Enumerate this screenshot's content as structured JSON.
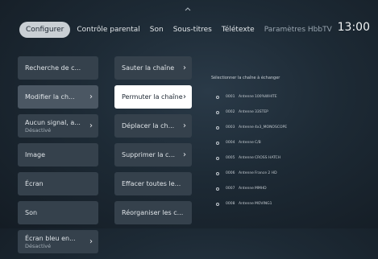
{
  "tabs": [
    {
      "label": "Configurer",
      "active": true
    },
    {
      "label": "Contrôle parental"
    },
    {
      "label": "Son"
    },
    {
      "label": "Sous-titres"
    },
    {
      "label": "Télétexte"
    },
    {
      "label": "Paramètres HbbTV",
      "faded": true
    }
  ],
  "clock": "13:00",
  "menu": [
    {
      "label": "Recherche de c..."
    },
    {
      "label": "Modifier la ch...",
      "arrow": "›"
    },
    {
      "label": "Aucun signal, a...",
      "sub": "Désactivé",
      "arrow": "›"
    },
    {
      "label": "Image"
    },
    {
      "label": "Écran"
    },
    {
      "label": "Son"
    },
    {
      "label": "Écran bleu en...",
      "sub": "Désactivé",
      "arrow": "›"
    }
  ],
  "submenu": [
    {
      "label": "Sauter la chaîne",
      "arrow": "›"
    },
    {
      "label": "Permuter la chaîne",
      "arrow": "›"
    },
    {
      "label": "Déplacer la ch...",
      "arrow": "›"
    },
    {
      "label": "Supprimer la c...",
      "arrow": "›"
    },
    {
      "label": "Effacer toutes le..."
    },
    {
      "label": "Réorganiser les c..."
    }
  ],
  "channel_panel": {
    "title": "Sélectionner la chaîne à échanger",
    "channels": [
      {
        "num": "0001",
        "source": "Antenne",
        "name": "100%WHITE"
      },
      {
        "num": "0002",
        "source": "Antenne",
        "name": "33STEP"
      },
      {
        "num": "0003",
        "source": "Antenne",
        "name": "4x3_MONOSCOPE"
      },
      {
        "num": "0004",
        "source": "Antenne",
        "name": "C/B"
      },
      {
        "num": "0005",
        "source": "Antenne",
        "name": "CROSS HATCH"
      },
      {
        "num": "0006",
        "source": "Antenne",
        "name": "France 2 HD"
      },
      {
        "num": "0007",
        "source": "Antenne",
        "name": "MMHD"
      },
      {
        "num": "0008",
        "source": "Antenne",
        "name": "MOVING1"
      }
    ]
  }
}
